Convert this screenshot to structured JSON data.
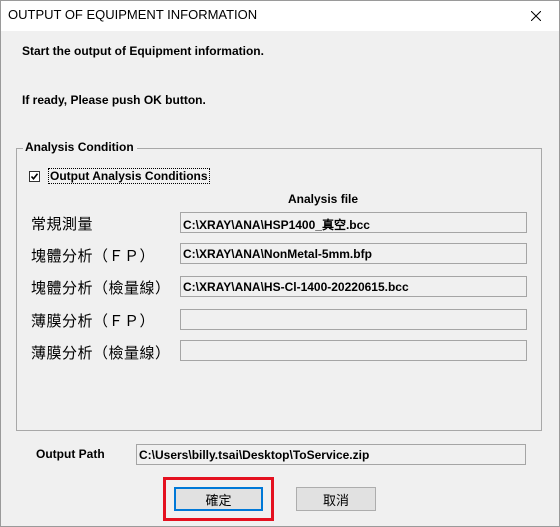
{
  "window": {
    "title": "OUTPUT OF EQUIPMENT INFORMATION"
  },
  "messages": {
    "line1": "Start the output of Equipment information.",
    "line2": "If ready, Please push OK button."
  },
  "analysis_condition": {
    "group_title": "Analysis Condition",
    "checkbox_label": "Output Analysis Conditions",
    "checkbox_checked": true,
    "column_header": "Analysis file",
    "rows": [
      {
        "label": "常規測量",
        "value": "C:\\XRAY\\ANA\\HSP1400_真空.bcc"
      },
      {
        "label": "塊體分析（ＦＰ）",
        "value": "C:\\XRAY\\ANA\\NonMetal-5mm.bfp"
      },
      {
        "label": "塊體分析（檢量線）",
        "value": "C:\\XRAY\\ANA\\HS-Cl-1400-20220615.bcc"
      },
      {
        "label": "薄膜分析（ＦＰ）",
        "value": ""
      },
      {
        "label": "薄膜分析（檢量線）",
        "value": ""
      }
    ]
  },
  "output_path": {
    "label": "Output Path",
    "value": "C:\\Users\\billy.tsai\\Desktop\\ToService.zip"
  },
  "buttons": {
    "ok": "確定",
    "cancel": "取消"
  },
  "colors": {
    "highlight": "#e4101f",
    "focus": "#0078d7"
  }
}
